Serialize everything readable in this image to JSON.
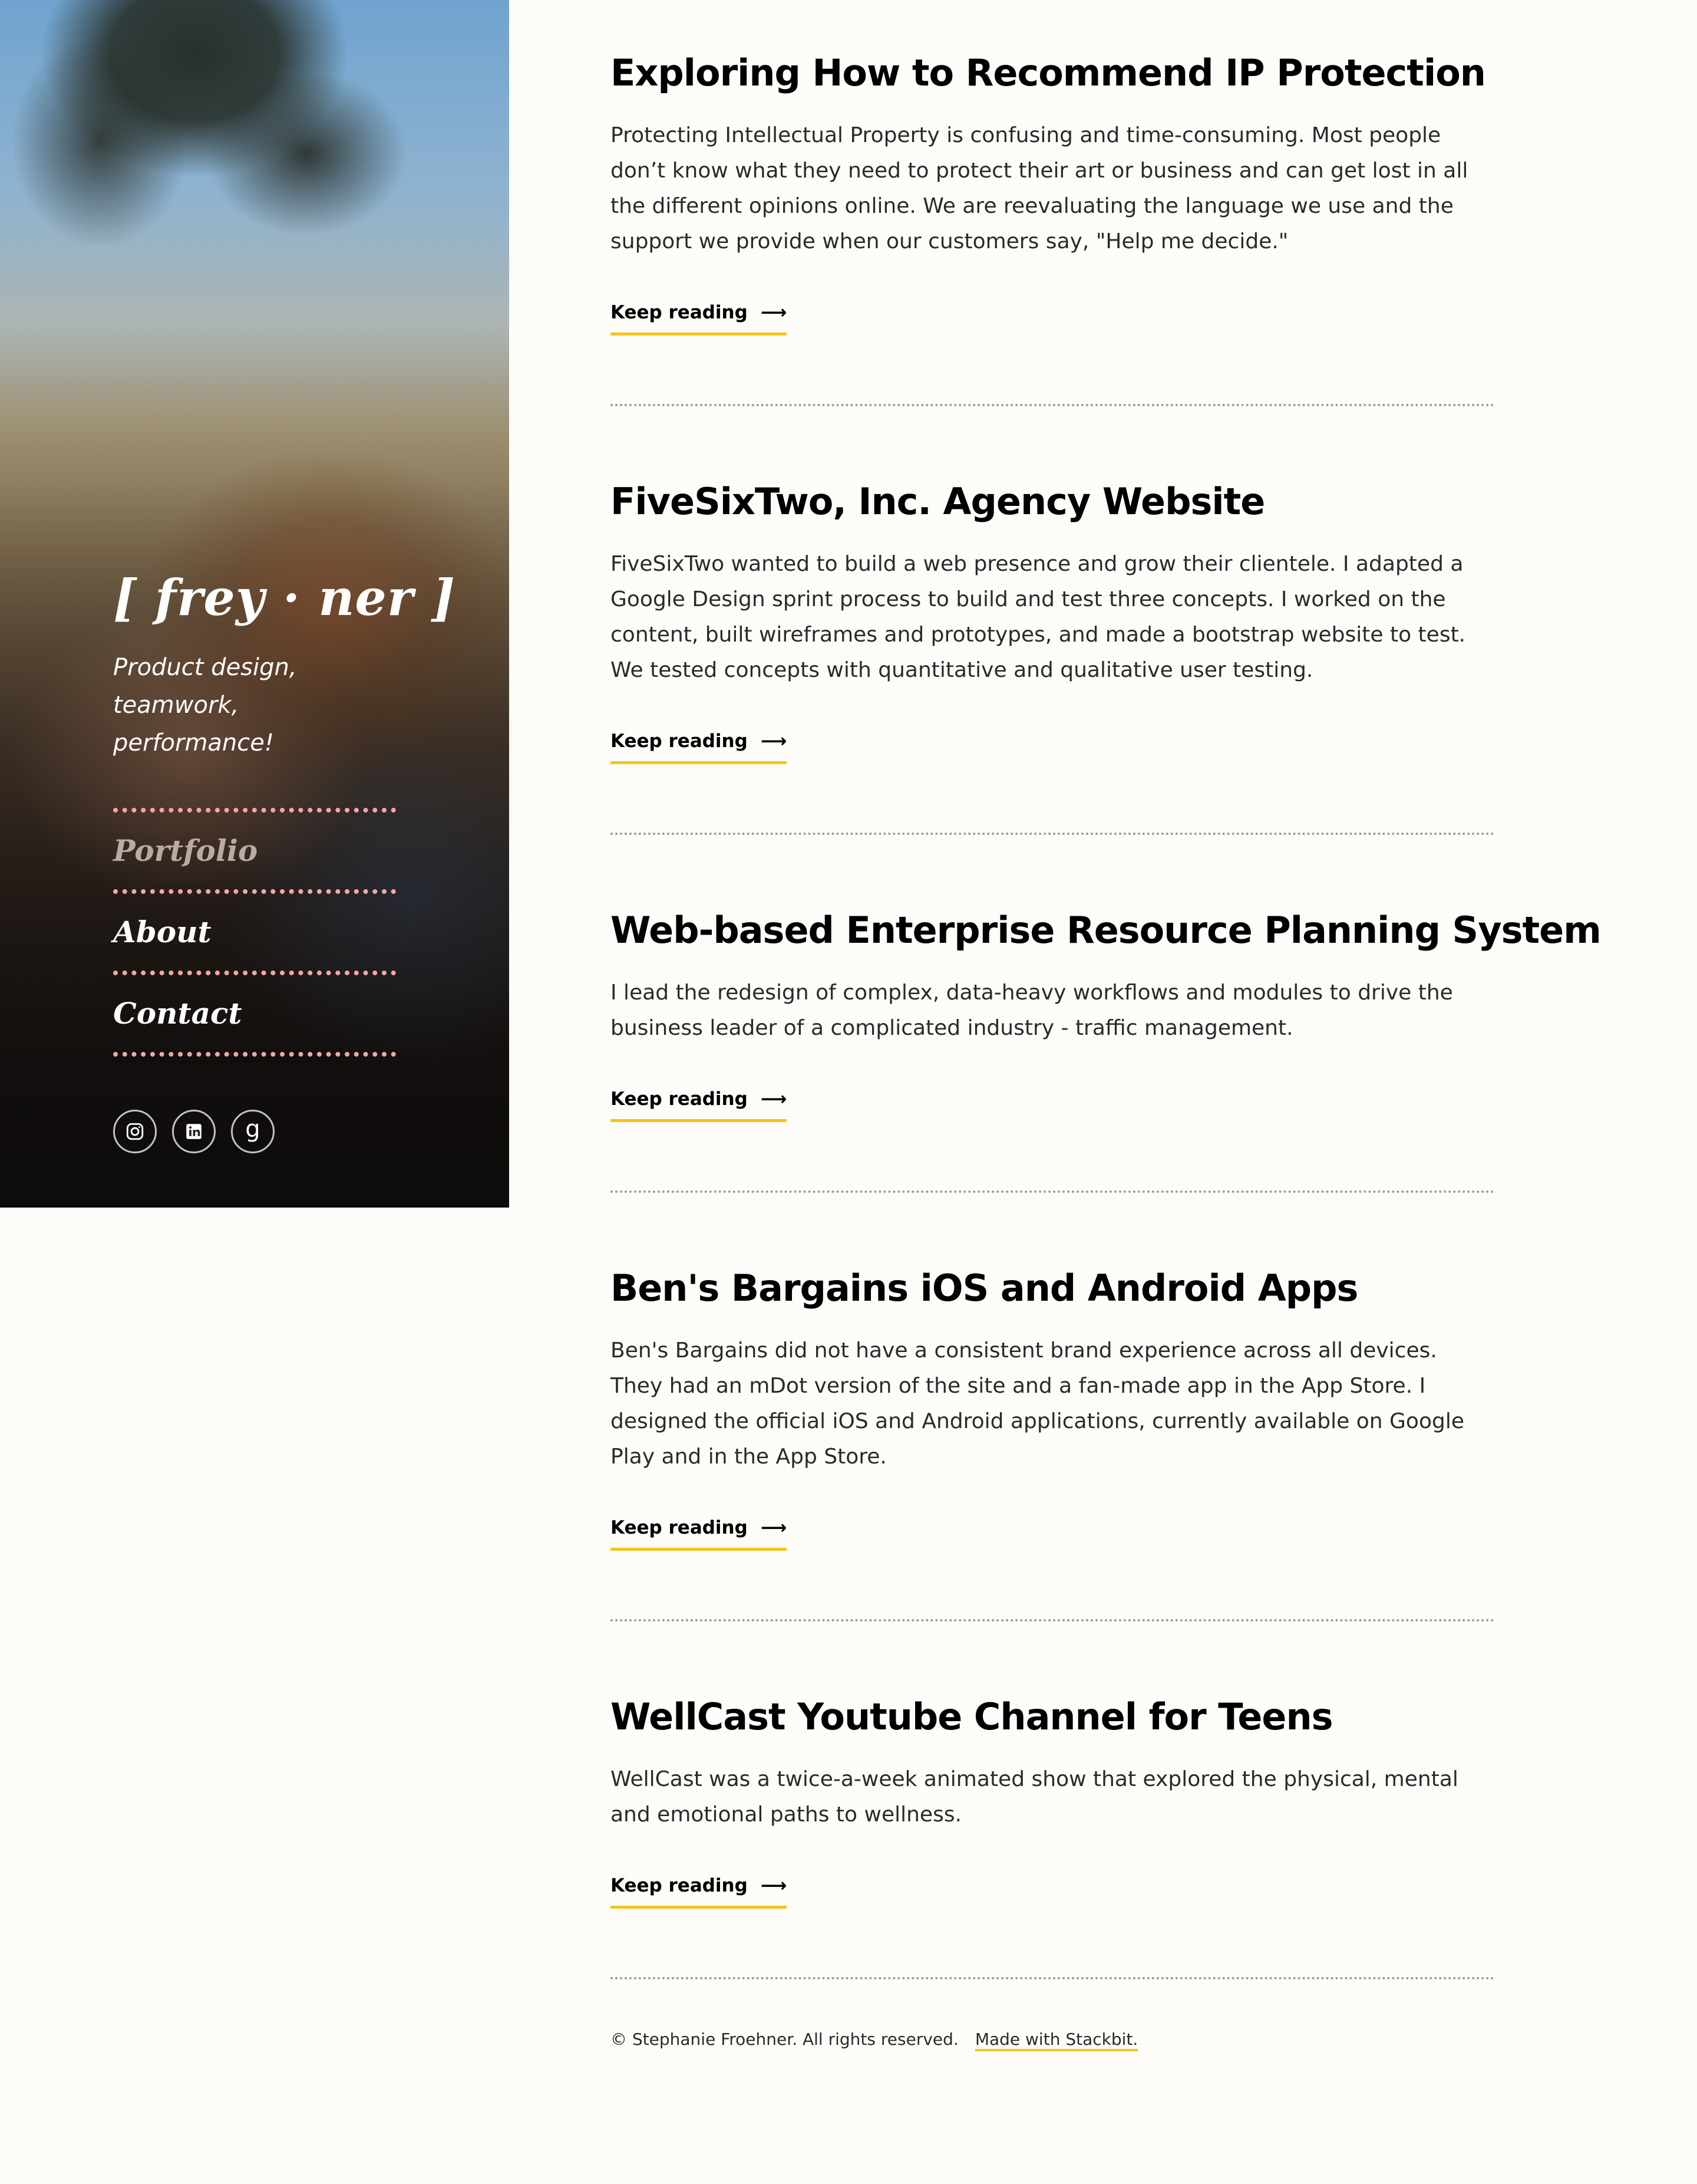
{
  "colors": {
    "page_background": "#fdfcf8",
    "accent_underline": "#f5c518",
    "nav_separator": "#f2a7a5",
    "nav_active": "#b7aba4",
    "title": "#000000",
    "body_text": "#2a2a2a"
  },
  "sidebar": {
    "logo": "[ frey · ner ]",
    "tagline": "Product design,\nteamwork, performance!",
    "nav": [
      {
        "label": "Portfolio",
        "active": true
      },
      {
        "label": "About",
        "active": false
      },
      {
        "label": "Contact",
        "active": false
      }
    ],
    "social": [
      {
        "icon": "instagram-icon"
      },
      {
        "icon": "linkedin-icon"
      },
      {
        "icon": "goodreads-icon",
        "glyph": "g"
      }
    ]
  },
  "posts": [
    {
      "title": "Exploring How to Recommend IP Protection",
      "excerpt": "Protecting Intellectual Property is confusing and time-consuming. Most people don’t know what they need to protect their art or business and can get lost in all the different opinions online. We are reevaluating the language we use and the support we provide when our customers say, \"Help me decide.\"",
      "link_label": "Keep reading"
    },
    {
      "title": "FiveSixTwo, Inc. Agency Website",
      "excerpt": "FiveSixTwo wanted to build a web presence and grow their clientele. I adapted a Google Design sprint process to build and test three concepts. I worked on the content, built wireframes and prototypes, and made a bootstrap website to test. We tested concepts with quantitative and qualitative user testing.",
      "link_label": "Keep reading"
    },
    {
      "title": "Web-based Enterprise Resource Planning System",
      "excerpt": "I lead the redesign of complex, data-heavy workflows and modules to drive the business leader of a complicated industry - traffic management.",
      "link_label": "Keep reading"
    },
    {
      "title": "Ben's Bargains iOS and Android Apps",
      "excerpt": "Ben's Bargains did not have a consistent brand experience across all devices. They had an mDot version of the site and a fan-made app in the App Store. I designed the official iOS and Android applications, currently available on Google Play and in the App Store.",
      "link_label": "Keep reading"
    },
    {
      "title": "WellCast Youtube Channel for Teens",
      "excerpt": "WellCast was a twice-a-week animated show that explored the physical, mental and emotional paths to wellness.",
      "link_label": "Keep reading"
    }
  ],
  "read_more_arrow": "⟶",
  "footer": {
    "copyright": "© Stephanie Froehner. All rights reserved.",
    "made_with": "Made with Stackbit."
  }
}
